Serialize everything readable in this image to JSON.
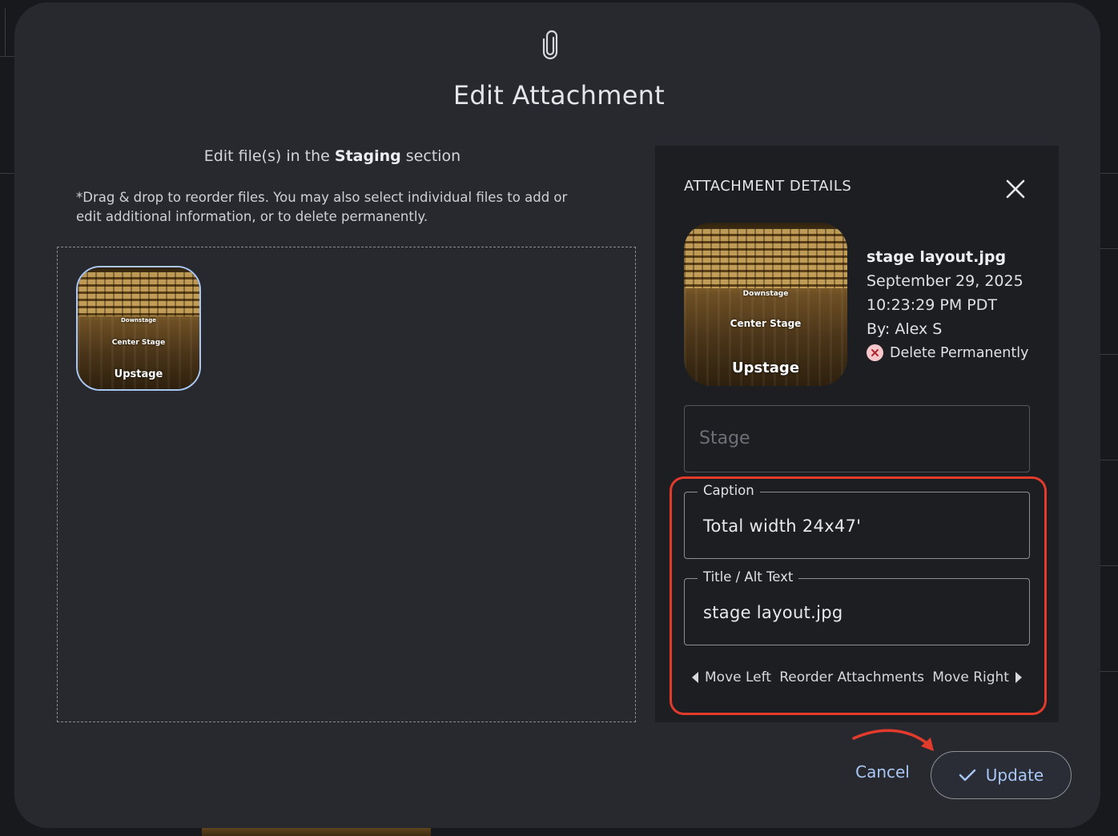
{
  "modal": {
    "title": "Edit Attachment",
    "icon": "paperclip-icon"
  },
  "editor": {
    "heading_prefix": "Edit file(s) in the",
    "heading_section": "Staging",
    "heading_suffix": "section",
    "hint": "*Drag & drop to reorder files. You may also select individual files to add or edit additional information, or to delete permanently."
  },
  "thumbnail": {
    "labels": {
      "downstage": "Downstage",
      "center": "Center Stage",
      "upstage": "Upstage"
    }
  },
  "details": {
    "title": "ATTACHMENT DETAILS",
    "file_name": "stage layout.jpg",
    "date": "September 29, 2025",
    "time": "10:23:29 PM PDT",
    "author": "By: Alex S",
    "delete_label": "Delete Permanently",
    "select_placeholder": "Stage",
    "caption_label": "Caption",
    "caption_value": "Total width 24x47'",
    "alt_label": "Title / Alt Text",
    "alt_value": "stage layout.jpg",
    "move_left": "Move Left",
    "reorder": "Reorder Attachments",
    "move_right": "Move Right"
  },
  "actions": {
    "cancel": "Cancel",
    "update": "Update"
  },
  "colors": {
    "accent": "#a9c7f5",
    "highlight": "#e23a2b",
    "modal_bg": "#28292e",
    "panel_bg": "#1d1e22"
  }
}
